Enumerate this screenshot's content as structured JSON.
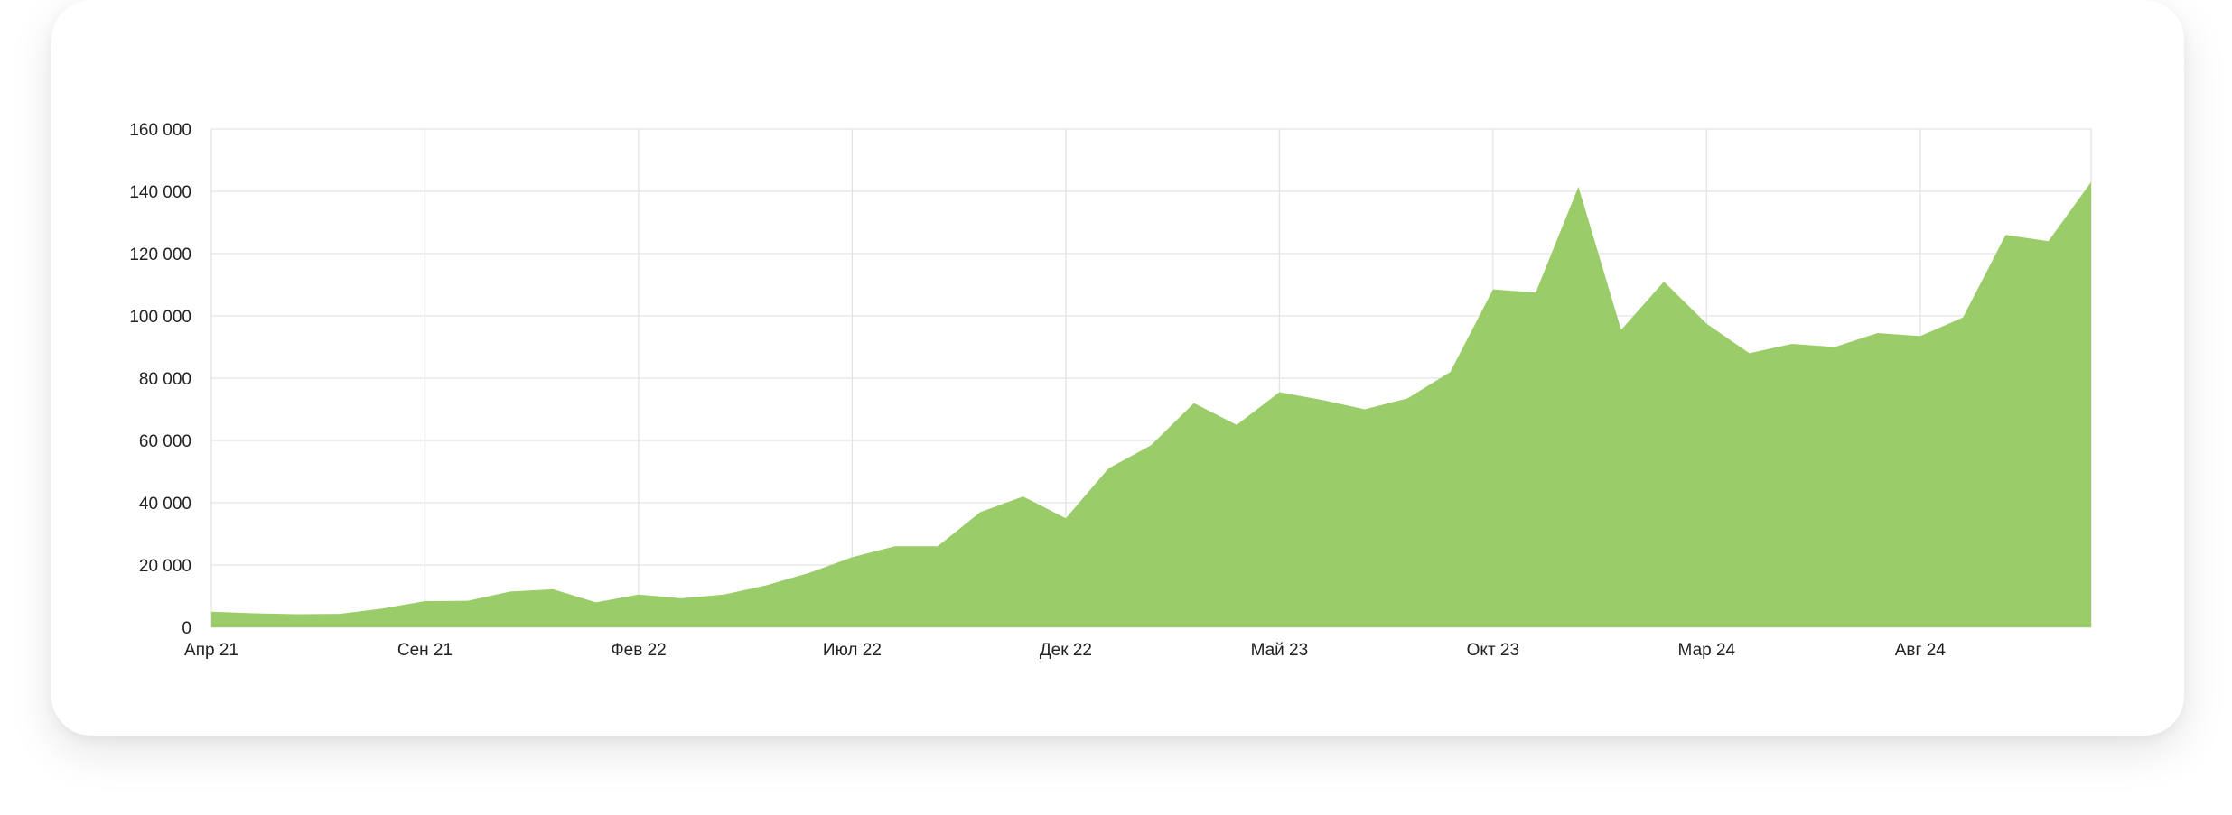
{
  "chart_data": {
    "type": "area",
    "title": "",
    "xlabel": "",
    "ylabel": "",
    "ylim": [
      0,
      160000
    ],
    "yticks": [
      0,
      20000,
      40000,
      60000,
      80000,
      100000,
      120000,
      140000,
      160000
    ],
    "ytick_labels": [
      "0",
      "20 000",
      "40 000",
      "60 000",
      "80 000",
      "100 000",
      "120 000",
      "140 000",
      "160 000"
    ],
    "xtick_labels": [
      "Апр 21",
      "Сен 21",
      "Фев 22",
      "Июл 22",
      "Дек 22",
      "Май 23",
      "Окт 23",
      "Мар 24",
      "Авг 24"
    ],
    "xtick_index": [
      0,
      5,
      10,
      15,
      20,
      25,
      30,
      35,
      40
    ],
    "grid": true,
    "fill_color": "#99cb67",
    "x": [
      "2021-04",
      "2021-05",
      "2021-06",
      "2021-07",
      "2021-08",
      "2021-09",
      "2021-10",
      "2021-11",
      "2021-12",
      "2022-01",
      "2022-02",
      "2022-03",
      "2022-04",
      "2022-05",
      "2022-06",
      "2022-07",
      "2022-08",
      "2022-09",
      "2022-10",
      "2022-11",
      "2022-12",
      "2023-01",
      "2023-02",
      "2023-03",
      "2023-04",
      "2023-05",
      "2023-06",
      "2023-07",
      "2023-08",
      "2023-09",
      "2023-10",
      "2023-11",
      "2023-12",
      "2024-01",
      "2024-02",
      "2024-03",
      "2024-04",
      "2024-05",
      "2024-06",
      "2024-07",
      "2024-08",
      "2024-09",
      "2024-10",
      "2024-11",
      "2024-12"
    ],
    "values": [
      5000,
      4500,
      4200,
      4300,
      6000,
      8400,
      8500,
      11500,
      12200,
      8000,
      10500,
      9300,
      10500,
      13500,
      17500,
      22500,
      26000,
      26000,
      37000,
      42000,
      35000,
      51000,
      58500,
      72000,
      65000,
      75500,
      73000,
      70000,
      73500,
      82000,
      108500,
      107500,
      141500,
      95500,
      111000,
      97500,
      88000,
      91000,
      90000,
      94500,
      93500,
      99500,
      126000,
      124000,
      143000
    ]
  }
}
